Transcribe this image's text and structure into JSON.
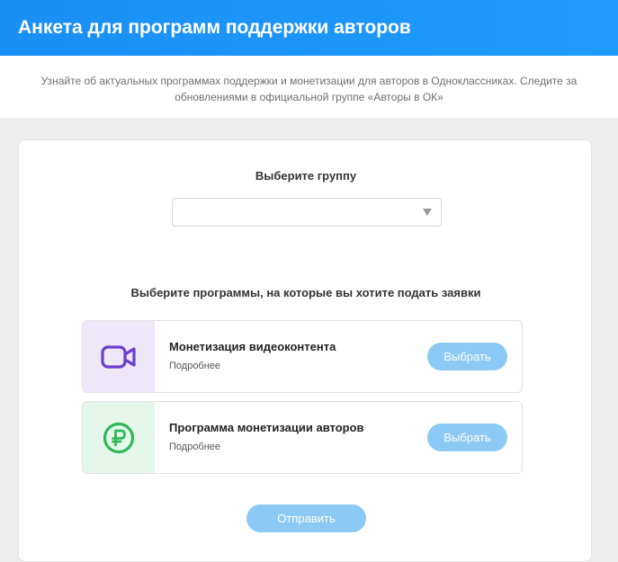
{
  "header": {
    "title": "Анкета для программ поддержки авторов"
  },
  "intro": {
    "text": "Узнайте об актуальных программах поддержки и монетизации для авторов в Одноклассниках. Следите за обновлениями в официальной группе «Авторы в ОК»"
  },
  "form": {
    "group_label": "Выберите группу",
    "group_select": {
      "value": ""
    },
    "programs_label": "Выберите программы, на которые вы хотите подать заявки",
    "programs": [
      {
        "title": "Монетизация видеоконтента",
        "more_label": "Подробнее",
        "button_label": "Выбрать",
        "icon": "video-camera-icon",
        "icon_color": "#6a3fcf"
      },
      {
        "title": "Программа монетизации авторов",
        "more_label": "Подробнее",
        "button_label": "Выбрать",
        "icon": "ruble-icon",
        "icon_color": "#2fb85a"
      }
    ],
    "submit_label": "Отправить"
  },
  "colors": {
    "header_bg": "#1a8ff5",
    "button_bg": "#8ccaf5"
  }
}
